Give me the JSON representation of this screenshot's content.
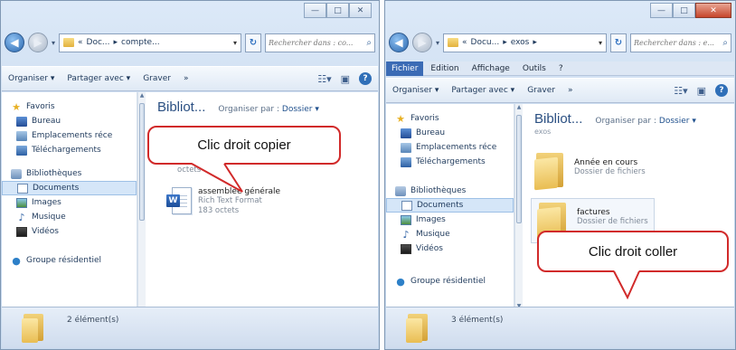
{
  "left_window": {
    "address": {
      "segments": [
        "«",
        "Doc...",
        "▸",
        "compte..."
      ]
    },
    "search": {
      "placeholder": "Rechercher dans : co..."
    },
    "toolbar": {
      "organize": "Organiser ▾",
      "share": "Partager avec ▾",
      "burn": "Graver",
      "more": "»"
    },
    "nav": {
      "favorites": "Favoris",
      "desktop": "Bureau",
      "recent": "Emplacements réce",
      "downloads": "Téléchargements",
      "libraries": "Bibliothèques",
      "documents": "Documents",
      "images": "Images",
      "music": "Musique",
      "videos": "Vidéos",
      "homegroup": "Groupe résidentiel"
    },
    "header": {
      "title": "Bibliot...",
      "arrange_label": "Organiser par :",
      "arrange_value": "Dossier ▾"
    },
    "files": [
      {
        "meta_hidden": "octets"
      },
      {
        "name": "assemblée générale",
        "type": "Rich Text Format",
        "size": "183 octets"
      }
    ],
    "status": {
      "count": "2 élément(s)"
    },
    "callout": "Clic droit copier"
  },
  "right_window": {
    "address": {
      "segments": [
        "«",
        "Docu...",
        "▸",
        "exos",
        "▸"
      ]
    },
    "search": {
      "placeholder": "Rechercher dans : e..."
    },
    "menu": [
      "Fichier",
      "Edition",
      "Affichage",
      "Outils",
      "?"
    ],
    "toolbar": {
      "organize": "Organiser ▾",
      "share": "Partager avec ▾",
      "burn": "Graver",
      "more": "»"
    },
    "nav": {
      "favorites": "Favoris",
      "desktop": "Bureau",
      "recent": "Emplacements réce",
      "downloads": "Téléchargements",
      "libraries": "Bibliothèques",
      "documents": "Documents",
      "images": "Images",
      "music": "Musique",
      "videos": "Vidéos",
      "homegroup": "Groupe résidentiel"
    },
    "header": {
      "title": "Bibliot...",
      "subtitle": "exos",
      "arrange_label": "Organiser par :",
      "arrange_value": "Dossier ▾"
    },
    "folders": [
      {
        "name": "Année en cours",
        "type": "Dossier de fichiers"
      },
      {
        "name": "factures",
        "type": "Dossier de fichiers"
      }
    ],
    "status": {
      "count": "3 élément(s)"
    },
    "callout": "Clic droit coller"
  },
  "window_controls": {
    "minimize": "—",
    "maximize": "□",
    "close": "✕"
  },
  "colors": {
    "callout_border": "#d12a2a",
    "selection": "#d5e6f8",
    "menu_active": "#3b6bb5"
  }
}
